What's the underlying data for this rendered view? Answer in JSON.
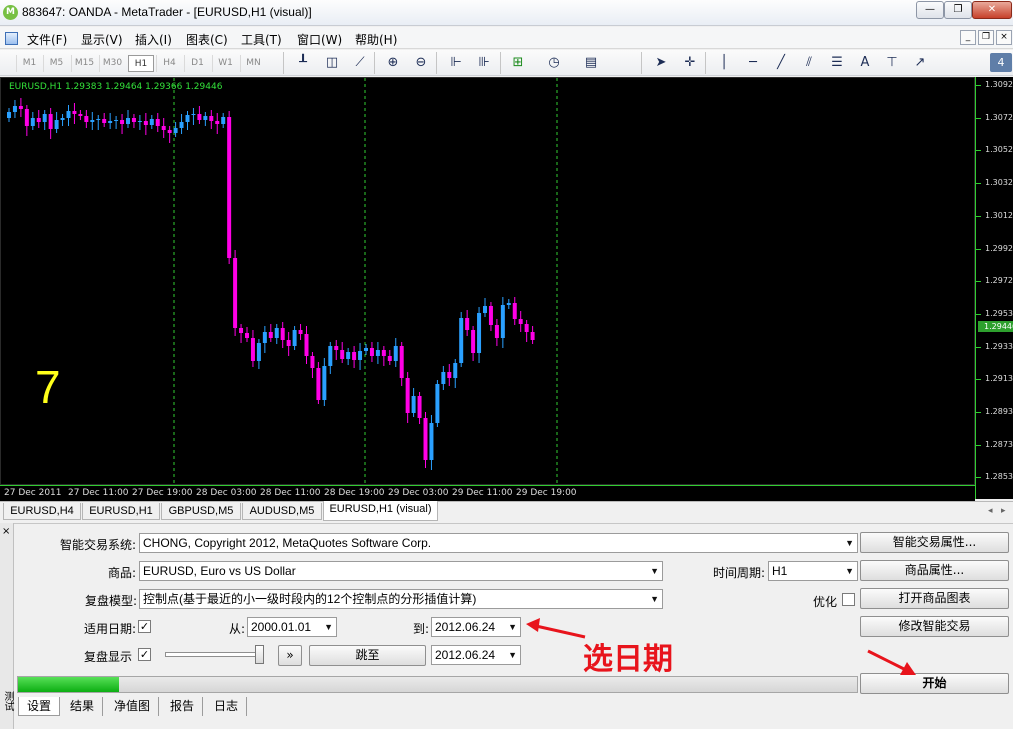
{
  "window": {
    "title": "883647: OANDA - MetaTrader - [EURUSD,H1 (visual)]",
    "logo_text": "M",
    "controls": [
      "—",
      "❐",
      "✕"
    ]
  },
  "menu": {
    "items": [
      "文件(F)",
      "显示(V)",
      "插入(I)",
      "图表(C)",
      "工具(T)",
      "窗口(W)",
      "帮助(H)"
    ],
    "mdi_controls": [
      "_",
      "❐",
      "×"
    ]
  },
  "toolbar": {
    "timeframes": [
      "M1",
      "M5",
      "M15",
      "M30",
      "H1",
      "H4",
      "D1",
      "W1",
      "MN"
    ],
    "badge": "4"
  },
  "chart": {
    "info": "EURUSD,H1  1.29383 1.29464 1.29366 1.29446",
    "overlay_number": "7",
    "price_labels": [
      "1.30920",
      "1.30720",
      "1.30520",
      "1.30320",
      "1.30125",
      "1.29925",
      "1.29725",
      "1.29530",
      "1.29330",
      "1.29130",
      "1.28930",
      "1.28735",
      "1.28535"
    ],
    "current_price": "1.29446",
    "time_labels": [
      "27 Dec 2011",
      "27 Dec 11:00",
      "27 Dec 19:00",
      "28 Dec 03:00",
      "28 Dec 11:00",
      "28 Dec 19:00",
      "29 Dec 03:00",
      "29 Dec 11:00",
      "29 Dec 19:00"
    ],
    "colors": {
      "bull": "#2aa0ff",
      "bear": "#ff00e6",
      "doji": "#ffffff",
      "grid": "#32cd32",
      "background": "#000000"
    }
  },
  "chart_tabs": [
    "EURUSD,H4",
    "EURUSD,H1",
    "GBPUSD,M5",
    "AUDUSD,M5",
    "EURUSD,H1 (visual)"
  ],
  "tester": {
    "expert_label": "智能交易系统:",
    "expert_value": "CHONG, Copyright 2012, MetaQuotes Software Corp.",
    "expert_props_btn": "智能交易属性...",
    "symbol_label": "商品:",
    "symbol_value": "EURUSD, Euro vs US Dollar",
    "period_label": "时间周期:",
    "period_value": "H1",
    "symbol_props_btn": "商品属性...",
    "model_label": "复盘模型:",
    "model_value": "控制点(基于最近的小一级时段内的12个控制点的分形插值计算)",
    "optimize_label": "优化",
    "open_chart_btn": "打开商品图表",
    "use_date_label": "适用日期:",
    "use_date_checked": "✓",
    "from_label": "从:",
    "from_value": "2000.01.01",
    "to_label": "到:",
    "to_value": "2012.06.24",
    "modify_expert_btn": "修改智能交易",
    "visual_label": "复盘显示",
    "visual_checked": "✓",
    "skip_btn": "»",
    "jump_btn": "跳至",
    "jump_date": "2012.06.24",
    "start_btn": "开始",
    "progress": 0.12,
    "side_label": "测试",
    "tabs": [
      "设置",
      "结果",
      "净值图",
      "报告",
      "日志"
    ]
  },
  "annotation": "选日期"
}
